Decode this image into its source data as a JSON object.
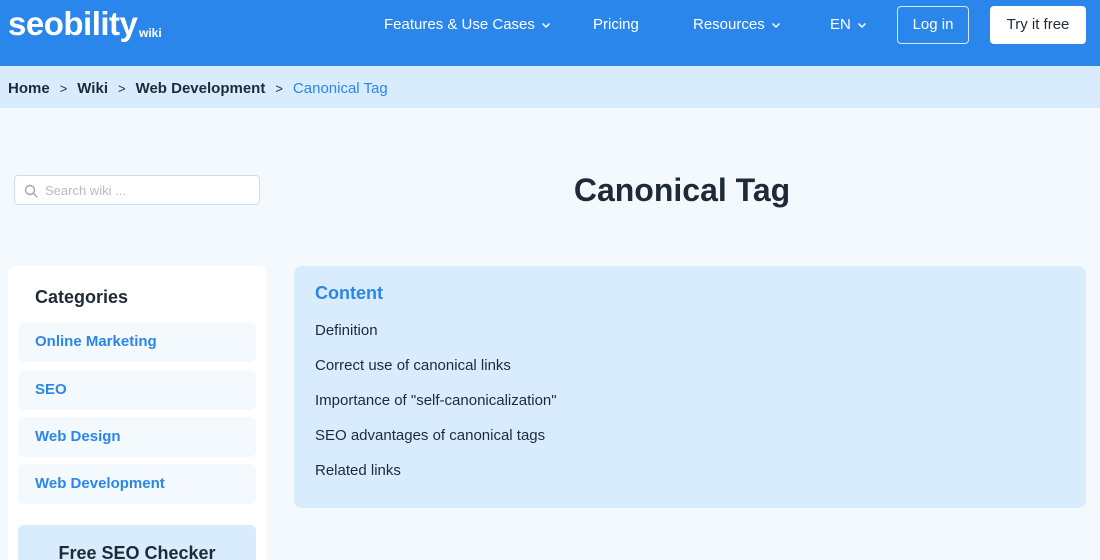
{
  "header": {
    "logo": "seobility",
    "logo_sub": "wiki",
    "nav": {
      "features": "Features & Use Cases",
      "pricing": "Pricing",
      "resources": "Resources",
      "language": "EN"
    },
    "login": "Log in",
    "try_free": "Try it free",
    "colors": {
      "brand": "#2a86ea",
      "text_dark": "#1e2a38",
      "light_blue": "#d9ecfd"
    }
  },
  "breadcrumb": {
    "items": [
      "Home",
      "Wiki",
      "Web Development"
    ],
    "current": "Canonical Tag",
    "separator": ">"
  },
  "search": {
    "placeholder": "Search wiki ..."
  },
  "title": "Canonical Tag",
  "sidebar": {
    "heading": "Categories",
    "categories": [
      "Online Marketing",
      "SEO",
      "Web Design",
      "Web Development"
    ],
    "checker": "Free SEO Checker"
  },
  "toc": {
    "heading": "Content",
    "items": [
      "Definition",
      "Correct use of canonical links",
      "Importance of \"self-canonicalization\"",
      "SEO advantages of canonical tags",
      "Related links"
    ]
  }
}
